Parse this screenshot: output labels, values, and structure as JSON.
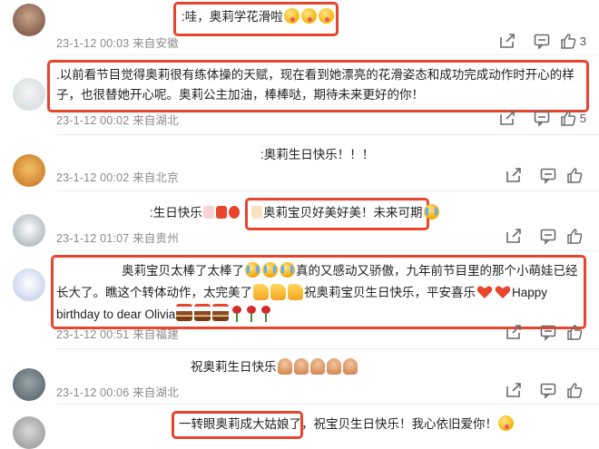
{
  "comments": [
    {
      "text": ":哇，奥莉学花滑啦",
      "meta": "23-1-12 00:03 来自安徽",
      "likes": "3"
    },
    {
      "text": ".以前看节目觉得奥莉很有练体操的天赋，现在看到她漂亮的花滑姿态和成功完成动作时开心的样子，也很替她开心呢。奥莉公主加油，棒棒哒，期待未来更好的你！",
      "meta": "23-1-12 00:02 来自湖北",
      "likes": "5"
    },
    {
      "text": ":奥莉生日快乐！！！",
      "meta": "23-1-12 00:02 来自北京",
      "likes": ""
    },
    {
      "prefix": ":生日快乐",
      "text": "奥莉宝贝好美好美！未来可期",
      "meta": "23-1-12 01:07 来自贵州",
      "likes": ""
    },
    {
      "text_a": "奥莉宝贝太棒了太棒了",
      "text_b": "真的又感动又骄傲，九年前节目里的那个小萌娃已经长大了。瞧这个转体动作，太完美了",
      "text_c": "祝奥莉宝贝生日快乐，平安喜乐",
      "text_d": "Happy birthday to dear Olivia",
      "meta": "23-1-12 00:51 来自福建",
      "likes": ""
    },
    {
      "text": "祝奥莉生日快乐",
      "meta": "23-1-12 00:06 来自湖北",
      "likes": ""
    },
    {
      "text_a": "一转眼奥莉成大姑娘了",
      "text_b": "，祝宝贝生日快乐！我心依旧爱你！",
      "meta": "",
      "likes": ""
    }
  ],
  "colors": {
    "highlight": "#e8452c",
    "meta": "#8a8a8a"
  },
  "icons": {
    "share": "share-icon",
    "comment": "comment-icon",
    "like": "thumbs-up-icon"
  }
}
